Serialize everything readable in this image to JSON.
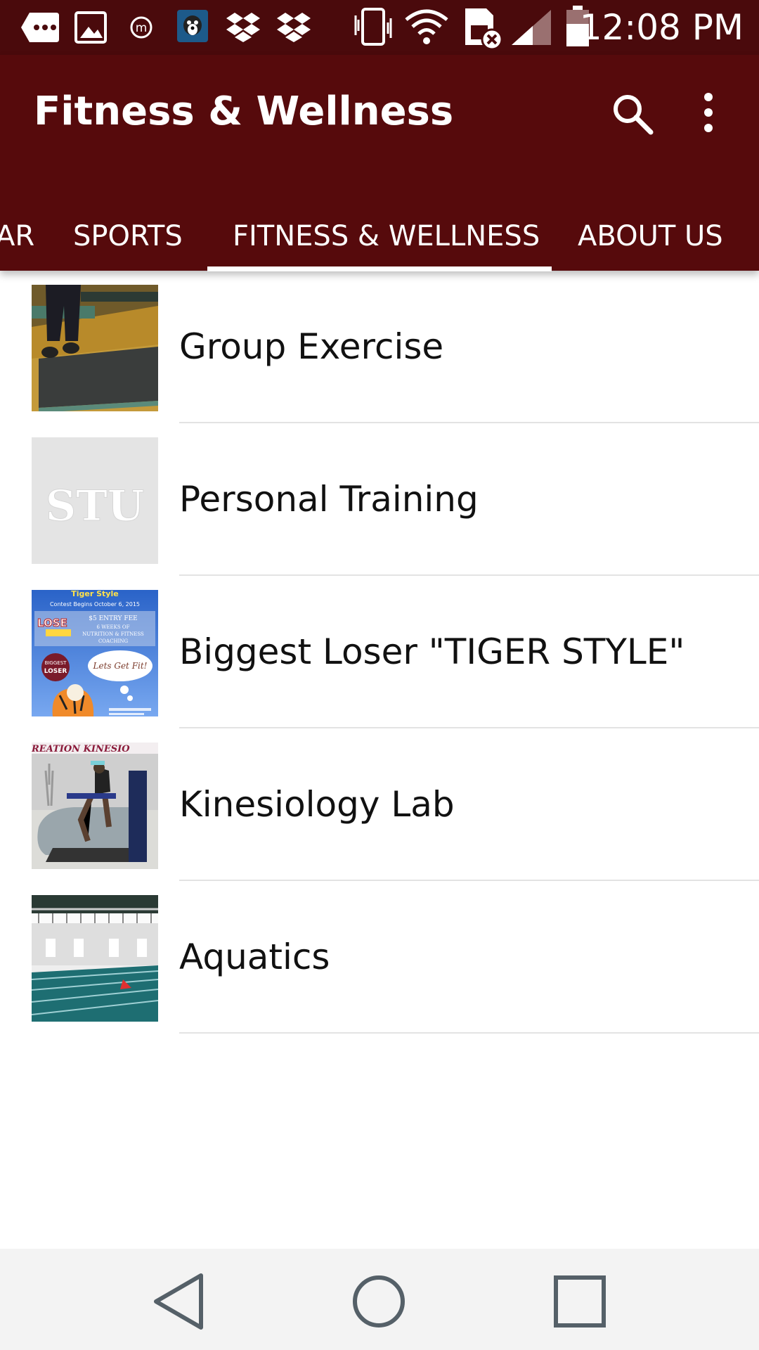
{
  "status_bar": {
    "time": "12:08 PM",
    "icons": [
      "chat-bubble-icon",
      "image-icon",
      "m-circle-icon",
      "dog-app-icon",
      "dropbox-icon",
      "dropbox-icon",
      "vibrate-icon",
      "wifi-icon",
      "no-sim-icon",
      "signal-icon",
      "battery-icon"
    ]
  },
  "app_bar": {
    "title": "Fitness & Wellness",
    "actions": [
      "search-icon",
      "more-vert-icon"
    ]
  },
  "tabs": [
    {
      "label": "AR"
    },
    {
      "label": "SPORTS"
    },
    {
      "label": "FITNESS & WELLNESS",
      "selected": true
    },
    {
      "label": "ABOUT US"
    }
  ],
  "list": [
    {
      "label": "Group Exercise"
    },
    {
      "label": "Personal Training",
      "thumb_text": "STU"
    },
    {
      "label": "Biggest Loser \"TIGER STYLE\"",
      "thumb_text": [
        "Tiger Style",
        "Contest Begins October 6, 2015",
        "$5 ENTRY FEE",
        "6 WEEKS OF",
        "NUTRITION & FITNESS",
        "COACHING",
        "LOSE",
        "BIGGEST",
        "LOSER",
        "Lets Get Fit!"
      ]
    },
    {
      "label": "Kinesiology Lab",
      "thumb_text": "REATION KINESIO"
    },
    {
      "label": "Aquatics"
    }
  ],
  "colors": {
    "primary": "#560a0c",
    "status_bar": "#4a0a0c",
    "indicator": "#ffffff",
    "nav_bar": "#f3f3f3"
  },
  "nav_bar": [
    "back-icon",
    "home-icon",
    "recents-icon"
  ]
}
